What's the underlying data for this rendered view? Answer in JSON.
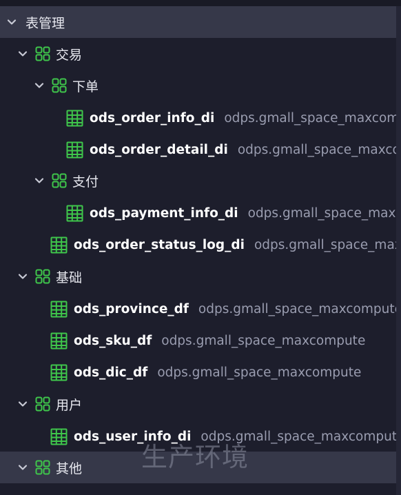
{
  "colors": {
    "accent": "#3fc64b",
    "background": "#1d1e2c",
    "highlight": "#363849",
    "source_text": "#9a9db0"
  },
  "tree": {
    "root": {
      "label": "表管理",
      "icon": "chevron-down-icon"
    },
    "trade": {
      "label": "交易",
      "icon": "folder-grid-icon"
    },
    "order": {
      "label": "下单",
      "icon": "folder-grid-icon"
    },
    "t_order_info": {
      "name": "ods_order_info_di",
      "source": "odps.gmall_space_maxcompute",
      "icon": "table-icon"
    },
    "t_order_detail": {
      "name": "ods_order_detail_di",
      "source": "odps.gmall_space_maxcompute",
      "icon": "table-icon"
    },
    "payment": {
      "label": "支付",
      "icon": "folder-grid-icon"
    },
    "t_payment_info": {
      "name": "ods_payment_info_di",
      "source": "odps.gmall_space_maxcompute",
      "icon": "table-icon"
    },
    "t_order_status_log": {
      "name": "ods_order_status_log_di",
      "source": "odps.gmall_space_maxcompute",
      "icon": "table-icon"
    },
    "basic": {
      "label": "基础",
      "icon": "folder-grid-icon"
    },
    "t_province": {
      "name": "ods_province_df",
      "source": "odps.gmall_space_maxcompute",
      "icon": "table-icon"
    },
    "t_sku": {
      "name": "ods_sku_df",
      "source": "odps.gmall_space_maxcompute",
      "icon": "table-icon"
    },
    "t_dic": {
      "name": "ods_dic_df",
      "source": "odps.gmall_space_maxcompute",
      "icon": "table-icon"
    },
    "user": {
      "label": "用户",
      "icon": "folder-grid-icon"
    },
    "t_user_info": {
      "name": "ods_user_info_di",
      "source": "odps.gmall_space_maxcompute",
      "icon": "table-icon"
    },
    "other": {
      "label": "其他",
      "icon": "folder-grid-icon"
    }
  },
  "watermark": "生产环境"
}
